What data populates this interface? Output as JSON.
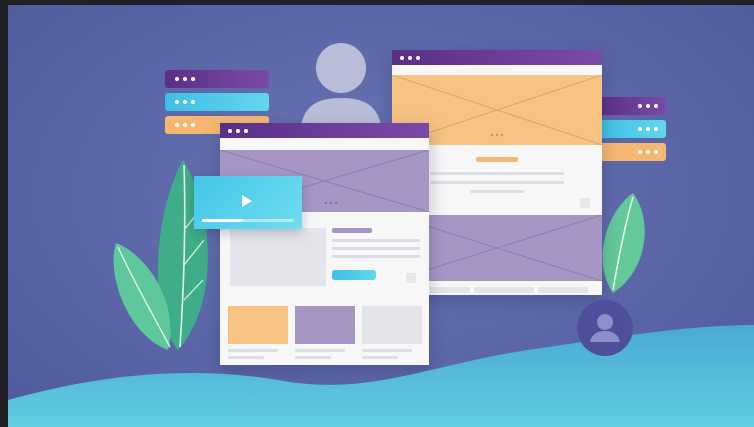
{
  "colors": {
    "background": "#5b66a8",
    "window_bar": "#5a2f86",
    "orange": "#f7c27d",
    "purple_placeholder": "#a496c2",
    "cyan": "#5ad4ea",
    "leaf_green": "#4fc08f",
    "wave": "#4fb7d6"
  },
  "icons": {
    "user": "user-silhouette-icon",
    "play": "play-icon",
    "account": "account-circle-icon",
    "window_controls": "three-dots-icon"
  },
  "video": {
    "progress": 0.45
  }
}
